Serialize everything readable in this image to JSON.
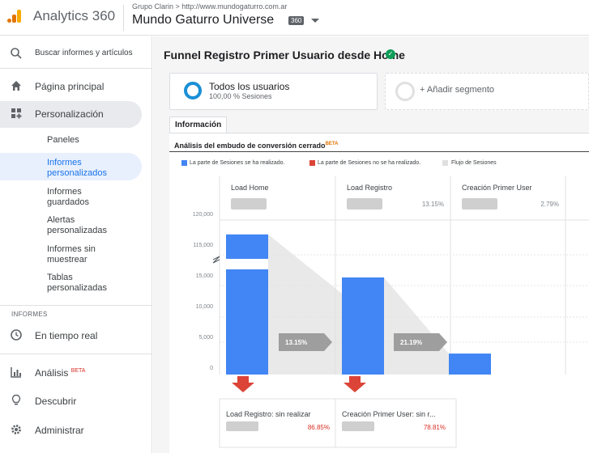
{
  "header": {
    "app_name": "Analytics 360",
    "account_crumb": "Grupo Clarin  >  http://www.mundogaturro.com.ar",
    "view_name": "Mundo Gaturro Universe",
    "view_badge": "360"
  },
  "sidebar": {
    "search_placeholder": "Buscar informes y artículos",
    "home": "Página principal",
    "customization": "Personalización",
    "sub_items": [
      "Paneles",
      "Informes personalizados",
      "Informes guardados",
      "Alertas personalizadas",
      "Informes sin muestrear",
      "Tablas personalizadas"
    ],
    "section_reports": "INFORMES",
    "realtime": "En tiempo real",
    "analysis": "Análisis",
    "analysis_badge": "BETA",
    "discover": "Descubrir",
    "admin": "Administrar"
  },
  "report": {
    "title": "Funnel Registro Primer Usuario desde Home",
    "segment_name": "Todos los usuarios",
    "segment_sub": "100,00 % Sesiones",
    "add_segment": "+ Añadir segmento",
    "tab": "Información",
    "funnel_title": "Análisis del embudo de conversión cerrado",
    "funnel_badge": "BETA",
    "legend": [
      {
        "label": "La parte de Sesiones se ha realizado.",
        "color": "#4285f4"
      },
      {
        "label": "La parte de Sesiones no se ha realizado.",
        "color": "#db4437"
      },
      {
        "label": "Flujo de Sesiones",
        "color": "#e0e0e0"
      }
    ]
  },
  "chart_data": {
    "type": "bar",
    "y_ticks": [
      "120,000",
      "115,000",
      "15,000",
      "10,000",
      "5,000",
      "0"
    ],
    "axis_break": true,
    "steps": [
      {
        "name": "Load Home",
        "value": 117000,
        "pct": ""
      },
      {
        "name": "Load Registro",
        "value": 15300,
        "pct": "13.15%"
      },
      {
        "name": "Creación Primer User",
        "value": 3240,
        "pct": "2.79%"
      }
    ],
    "flows": [
      "13.15%",
      "21.19%"
    ],
    "dropoffs": [
      {
        "label": "Load Registro: sin realizar",
        "pct": "86.85%"
      },
      {
        "label": "Creación Primer User: sin r...",
        "pct": "78.81%"
      }
    ],
    "colors": {
      "bar": "#4285f4",
      "drop": "#db4437",
      "flow": "#e0e0e0",
      "flow_arrow": "#9e9e9e"
    }
  }
}
